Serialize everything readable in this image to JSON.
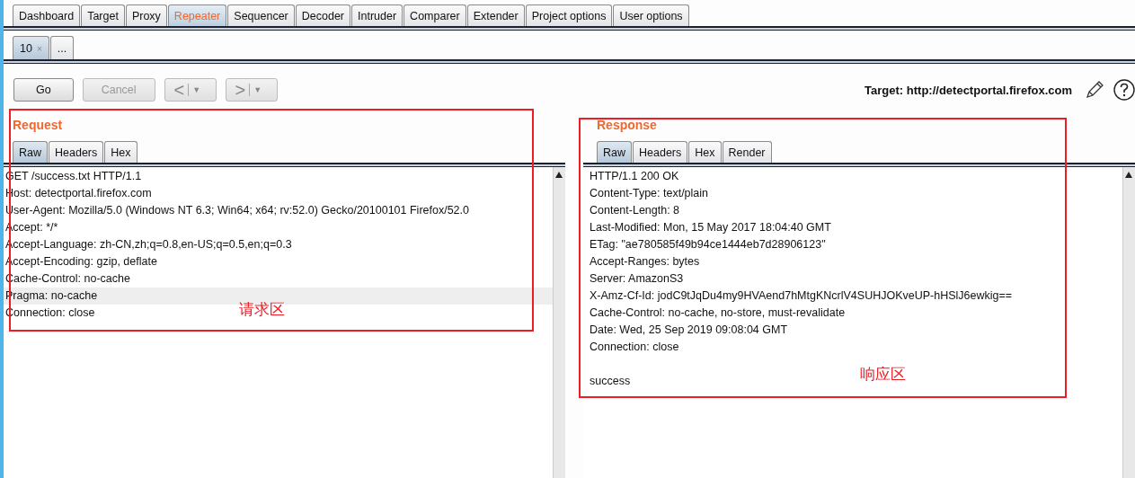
{
  "main_tabs": [
    {
      "label": "Dashboard",
      "selected": false
    },
    {
      "label": "Target",
      "selected": false
    },
    {
      "label": "Proxy",
      "selected": false
    },
    {
      "label": "Repeater",
      "selected": true
    },
    {
      "label": "Sequencer",
      "selected": false
    },
    {
      "label": "Decoder",
      "selected": false
    },
    {
      "label": "Intruder",
      "selected": false
    },
    {
      "label": "Comparer",
      "selected": false
    },
    {
      "label": "Extender",
      "selected": false
    },
    {
      "label": "Project options",
      "selected": false
    },
    {
      "label": "User options",
      "selected": false
    }
  ],
  "sub_tabs": [
    {
      "label": "10",
      "close": "×",
      "selected": true
    },
    {
      "label": "...",
      "selected": false
    }
  ],
  "toolbar": {
    "buttons": [
      {
        "label": "Go",
        "disabled": false
      },
      {
        "label": "Cancel",
        "disabled": true
      }
    ],
    "back": {
      "label": "<",
      "caret": "▼"
    },
    "forward": {
      "label": ">",
      "caret": "▼"
    },
    "target": "Target: http://detectportal.firefox.com"
  },
  "request": {
    "title": "Request",
    "tabs": [
      {
        "label": "Raw",
        "selected": true
      },
      {
        "label": "Headers",
        "selected": false
      },
      {
        "label": "Hex",
        "selected": false
      }
    ],
    "lines": [
      {
        "text": "GET /success.txt HTTP/1.1",
        "highlighted": false
      },
      {
        "text": "Host: detectportal.firefox.com",
        "highlighted": false
      },
      {
        "text": "User-Agent: Mozilla/5.0 (Windows NT 6.3; Win64; x64; rv:52.0) Gecko/20100101 Firefox/52.0",
        "highlighted": false
      },
      {
        "text": "Accept: */*",
        "highlighted": false
      },
      {
        "text": "Accept-Language: zh-CN,zh;q=0.8,en-US;q=0.5,en;q=0.3",
        "highlighted": false
      },
      {
        "text": "Accept-Encoding: gzip, deflate",
        "highlighted": false
      },
      {
        "text": "Cache-Control: no-cache",
        "highlighted": false
      },
      {
        "text": "Pragma: no-cache",
        "highlighted": true
      },
      {
        "text": "Connection: close",
        "highlighted": false
      }
    ],
    "annotation": "请求区"
  },
  "response": {
    "title": "Response",
    "tabs": [
      {
        "label": "Raw",
        "selected": true
      },
      {
        "label": "Headers",
        "selected": false
      },
      {
        "label": "Hex",
        "selected": false
      },
      {
        "label": "Render",
        "selected": false
      }
    ],
    "lines": [
      {
        "text": "HTTP/1.1 200 OK",
        "highlighted": false
      },
      {
        "text": "Content-Type: text/plain",
        "highlighted": false
      },
      {
        "text": "Content-Length: 8",
        "highlighted": false
      },
      {
        "text": "Last-Modified: Mon, 15 May 2017 18:04:40 GMT",
        "highlighted": false
      },
      {
        "text": "ETag: \"ae780585f49b94ce1444eb7d28906123\"",
        "highlighted": false
      },
      {
        "text": "Accept-Ranges: bytes",
        "highlighted": false
      },
      {
        "text": "Server: AmazonS3",
        "highlighted": false
      },
      {
        "text": "X-Amz-Cf-Id: jodC9tJqDu4my9HVAend7hMtgKNcrlV4SUHJOKveUP-hHSlJ6ewkig==",
        "highlighted": false
      },
      {
        "text": "Cache-Control: no-cache, no-store, must-revalidate",
        "highlighted": false
      },
      {
        "text": "Date: Wed, 25 Sep 2019 09:08:04 GMT",
        "highlighted": false
      },
      {
        "text": "Connection: close",
        "highlighted": false
      },
      {
        "text": "success",
        "highlighted": false,
        "gap_before": true
      }
    ],
    "annotation": "响应区"
  }
}
